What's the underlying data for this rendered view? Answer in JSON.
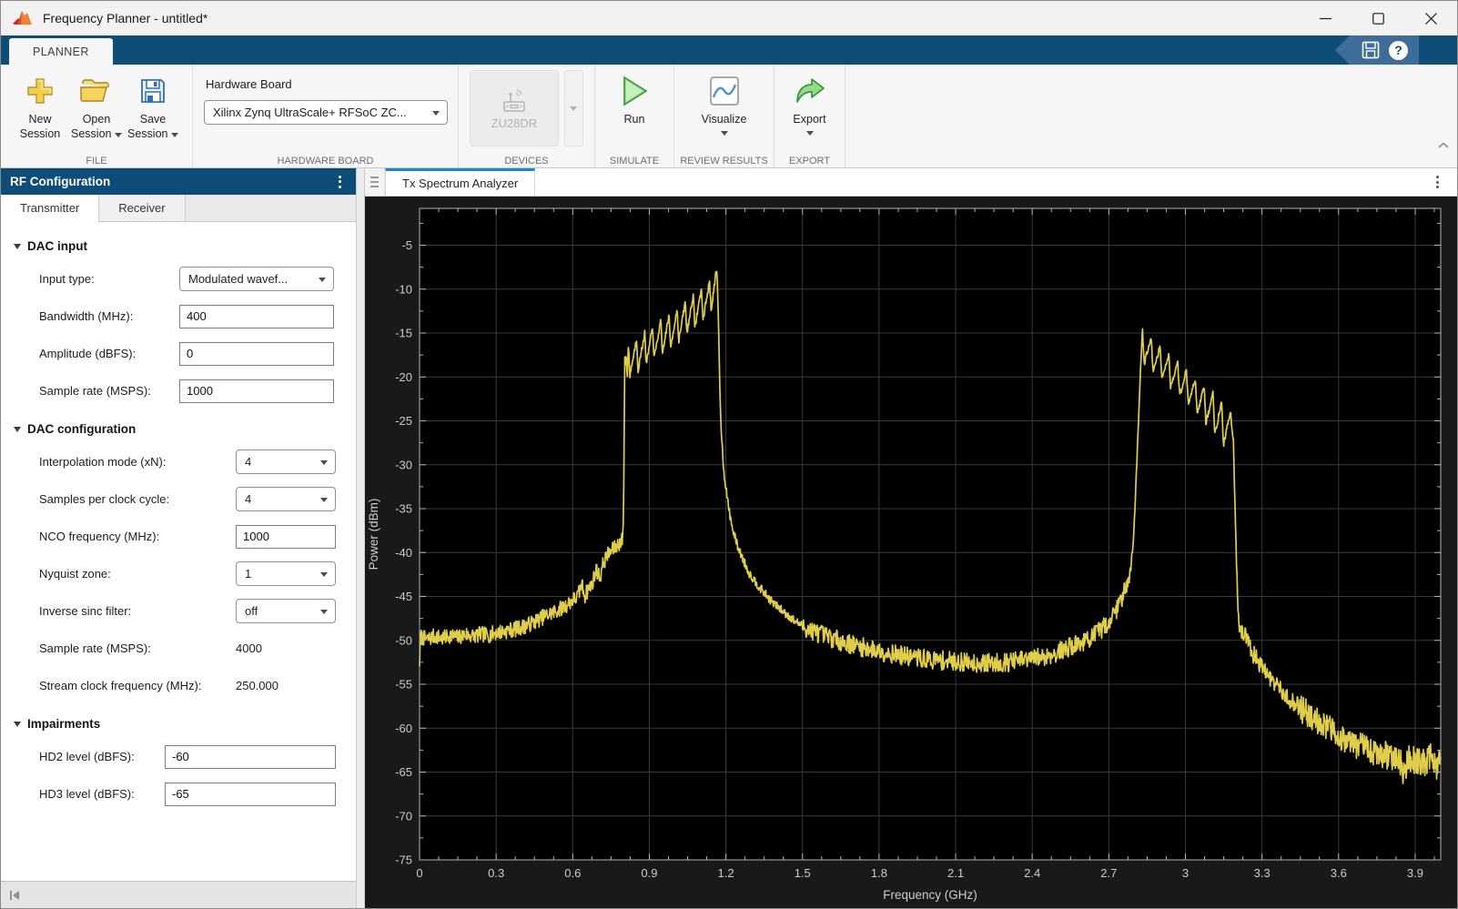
{
  "window": {
    "title": "Frequency Planner - untitled*"
  },
  "ribbon": {
    "active_tab": "PLANNER",
    "qab": {
      "help_glyph": "?"
    },
    "file": {
      "label": "FILE",
      "new": "New Session",
      "open": "Open Session",
      "save": "Save Session"
    },
    "hardware_board": {
      "label": "HARDWARE BOARD",
      "field_label": "Hardware Board",
      "value": "Xilinx Zynq UltraScale+ RFSoC ZC..."
    },
    "devices": {
      "label": "DEVICES",
      "device": "ZU28DR"
    },
    "simulate": {
      "label": "SIMULATE",
      "run": "Run"
    },
    "review_results": {
      "label": "REVIEW RESULTS",
      "visualize": "Visualize"
    },
    "export": {
      "label": "EXPORT",
      "export": "Export"
    }
  },
  "left_panel": {
    "title": "RF Configuration",
    "tabs": {
      "transmitter": "Transmitter",
      "receiver": "Receiver"
    },
    "dac_input": {
      "title": "DAC input",
      "input_type_label": "Input type:",
      "input_type_value": "Modulated wavef...",
      "bandwidth_label": "Bandwidth (MHz):",
      "bandwidth_value": "400",
      "amplitude_label": "Amplitude (dBFS):",
      "amplitude_value": "0",
      "sample_rate_label": "Sample rate (MSPS):",
      "sample_rate_value": "1000"
    },
    "dac_configuration": {
      "title": "DAC configuration",
      "interpolation_label": "Interpolation mode (xN):",
      "interpolation_value": "4",
      "samples_per_clock_label": "Samples per clock cycle:",
      "samples_per_clock_value": "4",
      "nco_label": "NCO frequency (MHz):",
      "nco_value": "1000",
      "nyquist_label": "Nyquist zone:",
      "nyquist_value": "1",
      "inverse_sinc_label": "Inverse sinc filter:",
      "inverse_sinc_value": "off",
      "sample_rate_label": "Sample rate (MSPS):",
      "sample_rate_value": "4000",
      "stream_clock_label": "Stream clock frequency (MHz):",
      "stream_clock_value": "250.000"
    },
    "impairments": {
      "title": "Impairments",
      "hd2_label": "HD2 level (dBFS):",
      "hd2_value": "-60",
      "hd3_label": "HD3 level (dBFS):",
      "hd3_value": "-65"
    }
  },
  "document": {
    "tab": "Tx Spectrum Analyzer"
  },
  "chart_data": {
    "type": "line",
    "title": "",
    "xlabel": "Frequency (GHz)",
    "ylabel": "Power (dBm)",
    "xlim": [
      0,
      4
    ],
    "ylim": [
      -75,
      -0.8
    ],
    "xticks": [
      0,
      0.3,
      0.6,
      0.9,
      1.2,
      1.5,
      1.8,
      2.1,
      2.4,
      2.7,
      3,
      3.3,
      3.6,
      3.9
    ],
    "yticks": [
      -75,
      -70,
      -65,
      -60,
      -55,
      -50,
      -45,
      -40,
      -35,
      -30,
      -25,
      -20,
      -15,
      -10,
      -5
    ],
    "x_minor_step": 0.075,
    "y_minor_step": 2.5,
    "grid": true,
    "legend": null,
    "colors": {
      "background": "#000000",
      "figure": "#191919",
      "grid": "#3a3a3a",
      "axis": "#b5b5b5",
      "tick_label": "#cccccc",
      "trace": "#ecd94f"
    },
    "series": [
      {
        "name": "Tx spectrum",
        "sample_step_ghz": 0.002,
        "noise_seed": 7,
        "noise_segments": [
          {
            "range": [
              0,
              0.795
            ],
            "amp_db": 0.9
          },
          {
            "range": [
              0.795,
              1.167
            ],
            "amp_db": 0.35
          },
          {
            "range": [
              1.167,
              1.5
            ],
            "amp_db": 0.5
          },
          {
            "range": [
              1.5,
              2.79
            ],
            "amp_db": 1.1
          },
          {
            "range": [
              2.79,
              3.19
            ],
            "amp_db": 0.35
          },
          {
            "range": [
              3.19,
              3.45
            ],
            "amp_db": 1.0
          },
          {
            "range": [
              3.45,
              4.001
            ],
            "amp_db": 1.6
          }
        ],
        "envelope_points": [
          [
            0,
            -52.5
          ],
          [
            0.004,
            -49.6
          ],
          [
            0.03,
            -49.9
          ],
          [
            0.06,
            -49.5
          ],
          [
            0.09,
            -49.8
          ],
          [
            0.12,
            -49.4
          ],
          [
            0.15,
            -49.7
          ],
          [
            0.18,
            -49.3
          ],
          [
            0.21,
            -49.5
          ],
          [
            0.24,
            -49.3
          ],
          [
            0.27,
            -49.4
          ],
          [
            0.3,
            -49.1
          ],
          [
            0.33,
            -49.0
          ],
          [
            0.36,
            -48.8
          ],
          [
            0.39,
            -48.6
          ],
          [
            0.42,
            -48.3
          ],
          [
            0.45,
            -47.9
          ],
          [
            0.48,
            -47.4
          ],
          [
            0.51,
            -47.0
          ],
          [
            0.54,
            -46.6
          ],
          [
            0.57,
            -46.1
          ],
          [
            0.6,
            -45.4
          ],
          [
            0.62,
            -45.0
          ],
          [
            0.635,
            -43.6
          ],
          [
            0.648,
            -44.9
          ],
          [
            0.66,
            -44.2
          ],
          [
            0.675,
            -43.6
          ],
          [
            0.693,
            -41.9
          ],
          [
            0.706,
            -42.9
          ],
          [
            0.72,
            -41.2
          ],
          [
            0.735,
            -40.3
          ],
          [
            0.75,
            -39.9
          ],
          [
            0.765,
            -39.4
          ],
          [
            0.78,
            -39.0
          ],
          [
            0.795,
            -38.5
          ],
          [
            0.799,
            -36
          ],
          [
            0.802,
            -24
          ],
          [
            0.8035,
            -17.6
          ],
          [
            0.806,
            -18.6
          ],
          [
            0.8095,
            -17.2
          ],
          [
            0.8135,
            -20.3
          ],
          [
            0.818,
            -16.4
          ],
          [
            0.824,
            -19.8
          ],
          [
            0.85,
            -15.7
          ],
          [
            0.856,
            -19.2
          ],
          [
            0.882,
            -15.0
          ],
          [
            0.888,
            -18.6
          ],
          [
            0.913,
            -14.3
          ],
          [
            0.919,
            -17.9
          ],
          [
            0.945,
            -13.6
          ],
          [
            0.951,
            -17.4
          ],
          [
            0.977,
            -12.9
          ],
          [
            0.983,
            -16.7
          ],
          [
            1.009,
            -12.2
          ],
          [
            1.015,
            -16.0
          ],
          [
            1.041,
            -11.4
          ],
          [
            1.047,
            -15.1
          ],
          [
            1.072,
            -10.6
          ],
          [
            1.078,
            -14.4
          ],
          [
            1.104,
            -9.9
          ],
          [
            1.11,
            -13.5
          ],
          [
            1.136,
            -9.1
          ],
          [
            1.142,
            -12.4
          ],
          [
            1.16,
            -8.4
          ],
          [
            1.164,
            -8.3
          ],
          [
            1.167,
            -9.5
          ],
          [
            1.171,
            -14
          ],
          [
            1.176,
            -21
          ],
          [
            1.183,
            -27
          ],
          [
            1.193,
            -31
          ],
          [
            1.21,
            -34.8
          ],
          [
            1.225,
            -37.2
          ],
          [
            1.245,
            -39.2
          ],
          [
            1.26,
            -40.3
          ],
          [
            1.29,
            -42.3
          ],
          [
            1.33,
            -43.9
          ],
          [
            1.38,
            -45.6
          ],
          [
            1.42,
            -46.6
          ],
          [
            1.47,
            -47.8
          ],
          [
            1.52,
            -48.7
          ],
          [
            1.59,
            -49.5
          ],
          [
            1.65,
            -50.1
          ],
          [
            1.72,
            -50.7
          ],
          [
            1.8,
            -51.2
          ],
          [
            1.9,
            -51.8
          ],
          [
            2.0,
            -52.2
          ],
          [
            2.1,
            -52.4
          ],
          [
            2.2,
            -52.6
          ],
          [
            2.3,
            -52.5
          ],
          [
            2.4,
            -52.1
          ],
          [
            2.48,
            -51.6
          ],
          [
            2.55,
            -50.7
          ],
          [
            2.6,
            -50.2
          ],
          [
            2.65,
            -49.3
          ],
          [
            2.7,
            -47.9
          ],
          [
            2.73,
            -46.5
          ],
          [
            2.76,
            -44.5
          ],
          [
            2.78,
            -42.5
          ],
          [
            2.795,
            -39.5
          ],
          [
            2.805,
            -33
          ],
          [
            2.815,
            -26
          ],
          [
            2.825,
            -18.5
          ],
          [
            2.832,
            -14.7
          ],
          [
            2.839,
            -18.4
          ],
          [
            2.866,
            -15.6
          ],
          [
            2.873,
            -19.3
          ],
          [
            2.901,
            -16.5
          ],
          [
            2.908,
            -20.3
          ],
          [
            2.935,
            -17.4
          ],
          [
            2.942,
            -21.2
          ],
          [
            2.97,
            -18.3
          ],
          [
            2.977,
            -22.2
          ],
          [
            3.004,
            -19.2
          ],
          [
            3.011,
            -23.2
          ],
          [
            3.039,
            -20.1
          ],
          [
            3.046,
            -24.2
          ],
          [
            3.073,
            -21.0
          ],
          [
            3.08,
            -25.3
          ],
          [
            3.108,
            -21.9
          ],
          [
            3.115,
            -26.5
          ],
          [
            3.142,
            -22.9
          ],
          [
            3.149,
            -27.8
          ],
          [
            3.177,
            -23.9
          ],
          [
            3.184,
            -26.5
          ],
          [
            3.188,
            -27.3
          ],
          [
            3.193,
            -33
          ],
          [
            3.2,
            -41
          ],
          [
            3.207,
            -46.5
          ],
          [
            3.213,
            -48.6
          ],
          [
            3.225,
            -49.2
          ],
          [
            3.24,
            -49.8
          ],
          [
            3.255,
            -50.6
          ],
          [
            3.262,
            -52.3
          ],
          [
            3.268,
            -51.5
          ],
          [
            3.28,
            -52.2
          ],
          [
            3.3,
            -53.0
          ],
          [
            3.33,
            -54.2
          ],
          [
            3.37,
            -55.6
          ],
          [
            3.41,
            -56.8
          ],
          [
            3.46,
            -57.9
          ],
          [
            3.51,
            -58.9
          ],
          [
            3.56,
            -60.0
          ],
          [
            3.61,
            -61.0
          ],
          [
            3.66,
            -61.8
          ],
          [
            3.71,
            -62.4
          ],
          [
            3.76,
            -62.9
          ],
          [
            3.8,
            -63.2
          ],
          [
            3.84,
            -63.6
          ],
          [
            3.855,
            -65.5
          ],
          [
            3.87,
            -63.4
          ],
          [
            3.9,
            -63.6
          ],
          [
            3.93,
            -64.0
          ],
          [
            3.96,
            -63.4
          ],
          [
            3.985,
            -64.3
          ],
          [
            4,
            -63.4
          ]
        ]
      }
    ]
  }
}
